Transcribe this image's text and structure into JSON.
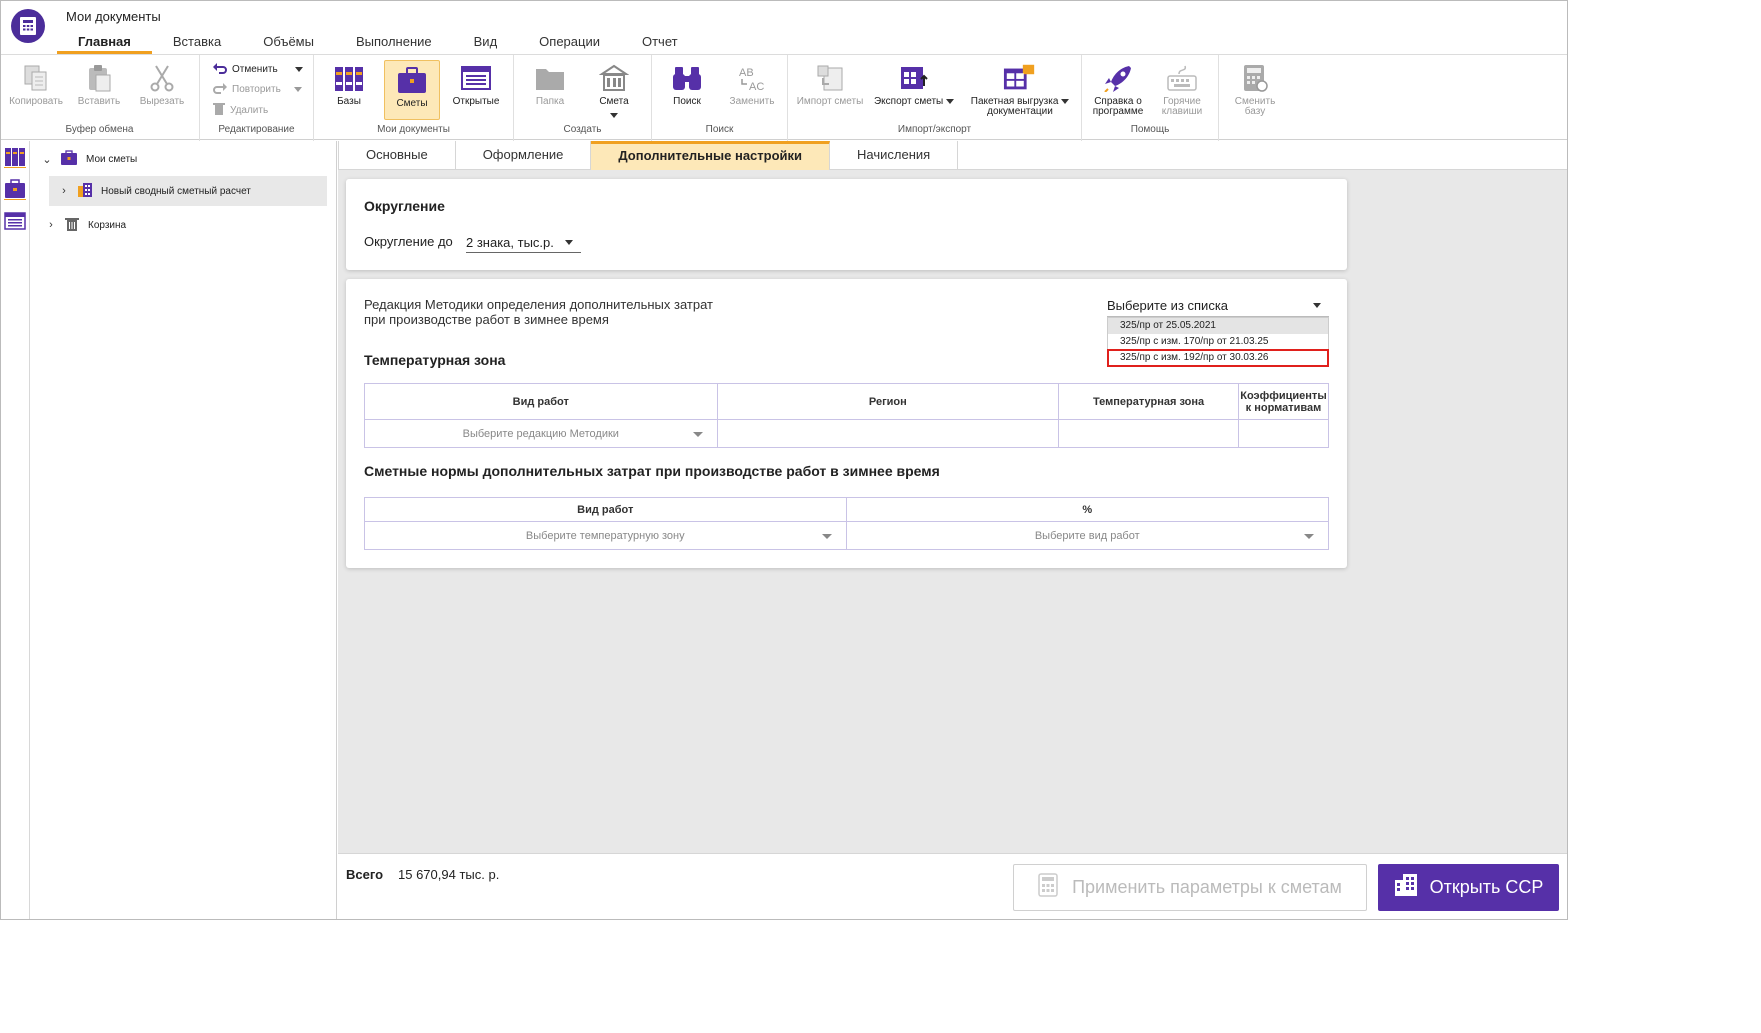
{
  "app": {
    "title": "Мои документы"
  },
  "menu": {
    "tabs": [
      "Главная",
      "Вставка",
      "Объёмы",
      "Выполнение",
      "Вид",
      "Операции",
      "Отчет"
    ],
    "active": 0
  },
  "ribbon": {
    "clipboard": {
      "label": "Буфер обмена",
      "copy": "Копировать",
      "paste": "Вставить",
      "cut": "Вырезать"
    },
    "editing": {
      "label": "Редактирование",
      "undo": "Отменить",
      "redo": "Повторить",
      "delete": "Удалить"
    },
    "my_docs": {
      "label": "Мои документы",
      "bases": "Базы",
      "estimates": "Сметы",
      "open": "Открытые"
    },
    "create": {
      "label": "Создать",
      "folder": "Папка",
      "estimate": "Смета"
    },
    "search": {
      "label": "Поиск",
      "find": "Поиск",
      "replace": "Заменить"
    },
    "import_export": {
      "label": "Импорт/экспорт",
      "import": "Импорт сметы",
      "export": "Экспорт сметы",
      "batch_line1": "Пакетная выгрузка",
      "batch_line2": "документации"
    },
    "help": {
      "label": "Помощь",
      "about_line1": "Справка о",
      "about_line2": "программе",
      "hotkeys_line1": "Горячие",
      "hotkeys_line2": "клавиши",
      "switch_line1": "Сменить",
      "switch_line2": "базу"
    }
  },
  "tree": {
    "root": "Мои сметы",
    "child": "Новый сводный сметный расчет",
    "trash": "Корзина"
  },
  "subtabs": [
    "Основные",
    "Оформление",
    "Дополнительные настройки",
    "Начисления"
  ],
  "rounding": {
    "title": "Округление",
    "label": "Округление до",
    "value": "2 знака, тыс.р."
  },
  "winter": {
    "description_line1": "Редакция Методики определения дополнительных затрат",
    "description_line2": "при производстве работ в зимнее время",
    "select_placeholder": "Выберите из списка",
    "options": [
      "325/пр от 25.05.2021",
      "325/пр с изм. 170/пр от 21.03.25",
      "325/пр с изм. 192/пр от 30.03.26"
    ],
    "temp_zone_title": "Температурная зона",
    "table1": {
      "headers": [
        "Вид работ",
        "Регион",
        "Температурная зона",
        "Коэффициенты к нормативам"
      ],
      "row": [
        "Выберите редакцию Методики",
        "",
        "",
        ""
      ]
    },
    "norms_title": "Сметные нормы дополнительных затрат при производстве работ в зимнее время",
    "table2": {
      "headers": [
        "Вид работ",
        "%"
      ],
      "row": [
        "Выберите температурную зону",
        "Выберите вид работ"
      ]
    }
  },
  "footer": {
    "total_label": "Всего",
    "total_value": "15 670,94 тыс. р.",
    "apply": "Применить параметры к сметам",
    "open_ssr": "Открыть ССР"
  },
  "colors": {
    "accent": "#5630a8",
    "highlight": "#f0a020",
    "selected_bg": "#fde8b8",
    "red_frame": "#e0201c"
  }
}
